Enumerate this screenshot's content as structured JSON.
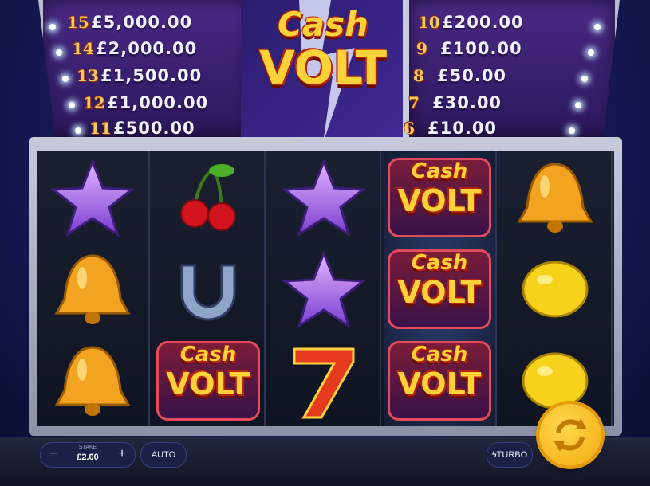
{
  "logo": {
    "line1": "Cash",
    "line2": "VOLT"
  },
  "paytable_left": [
    {
      "level": "15",
      "prize": "£5,000.00"
    },
    {
      "level": "14",
      "prize": "£2,000.00"
    },
    {
      "level": "13",
      "prize": "£1,500.00"
    },
    {
      "level": "12",
      "prize": "£1,000.00"
    },
    {
      "level": "11",
      "prize": "£500.00"
    }
  ],
  "paytable_right": [
    {
      "level": "10",
      "prize": "£200.00"
    },
    {
      "level": "9",
      "prize": "£100.00"
    },
    {
      "level": "8",
      "prize": "£50.00"
    },
    {
      "level": "7",
      "prize": "£30.00"
    },
    {
      "level": "6",
      "prize": "£10.00"
    }
  ],
  "reels": [
    [
      "star",
      "bell",
      "bell"
    ],
    [
      "cherries",
      "horseshoe",
      "cash-volt"
    ],
    [
      "star",
      "star",
      "seven"
    ],
    [
      "cash-volt",
      "cash-volt",
      "cash-volt"
    ],
    [
      "bell",
      "lemon",
      "lemon"
    ]
  ],
  "controls": {
    "stake_label": "STAKE",
    "stake_value": "£2.00",
    "minus": "−",
    "plus": "+",
    "auto": "AUTO",
    "turbo": "TURBO"
  },
  "colors": {
    "gold": "#ffd23a",
    "red": "#b3230f",
    "purple": "#2c175c"
  }
}
